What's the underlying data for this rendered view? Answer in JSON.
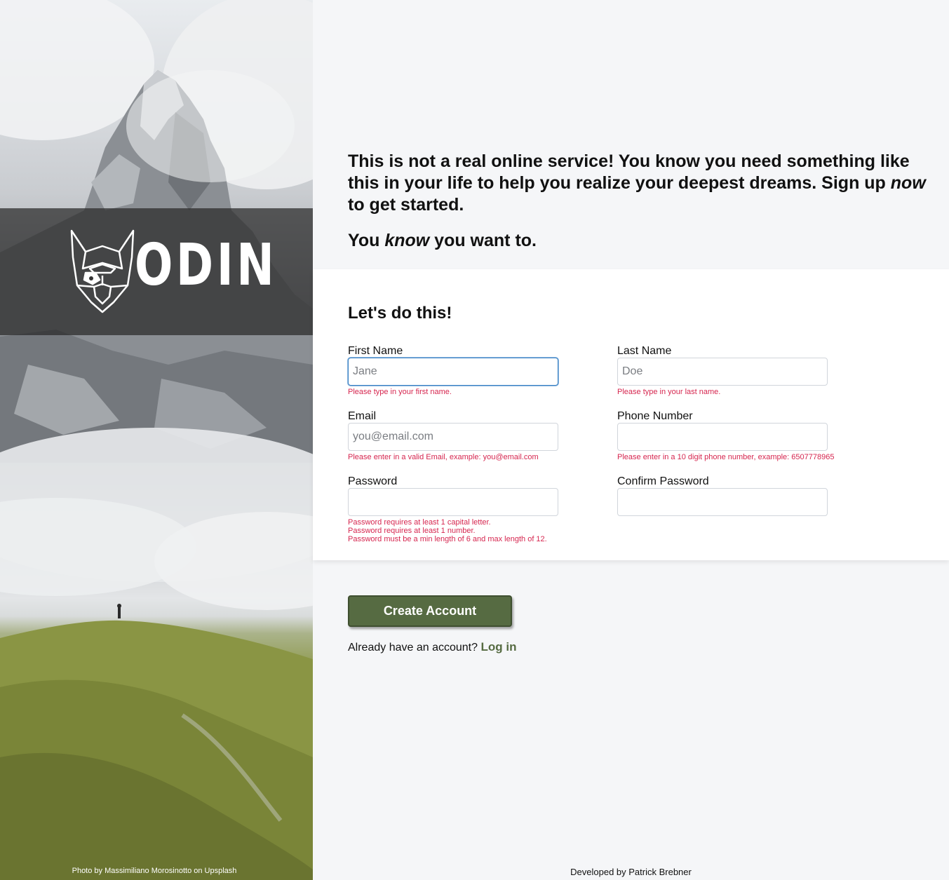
{
  "brand": {
    "logo_text": "ODIN",
    "photo_credit": "Photo by Massimiliano Morosinotto on Upsplash"
  },
  "intro": {
    "line1_a": "This is not a real online service! You know you need something like this in your life to help you realize your deepest dreams. Sign up ",
    "line1_em": "now",
    "line1_b": " to get started.",
    "line2_a": "You ",
    "line2_em": "know",
    "line2_b": " you want to."
  },
  "form": {
    "title": "Let's do this!",
    "first_name": {
      "label": "First Name",
      "placeholder": "Jane",
      "value": "",
      "error": "Please type in your first name."
    },
    "last_name": {
      "label": "Last Name",
      "placeholder": "Doe",
      "value": "",
      "error": "Please type in your last name."
    },
    "email": {
      "label": "Email",
      "placeholder": "you@email.com",
      "value": "",
      "error": "Please enter in a valid Email, example: you@email.com"
    },
    "phone": {
      "label": "Phone Number",
      "placeholder": "",
      "value": "",
      "error": "Please enter in a 10 digit phone number, example: 6507778965"
    },
    "password": {
      "label": "Password",
      "placeholder": "",
      "value": "",
      "errors": [
        "Password requires at least 1 capital letter.",
        "Password requires at least 1 number.",
        "Password must be a min length of 6 and max length of 12."
      ]
    },
    "confirm_password": {
      "label": "Confirm Password",
      "placeholder": "",
      "value": ""
    }
  },
  "actions": {
    "create_label": "Create Account",
    "login_prompt": "Already have an account?",
    "login_link": "Log in"
  },
  "footer": {
    "dev_credit": "Developed by Patrick Brebner"
  },
  "colors": {
    "accent": "#566b42",
    "error": "#d6264f",
    "focus": "#3b82c4",
    "background": "#f5f6f8"
  }
}
